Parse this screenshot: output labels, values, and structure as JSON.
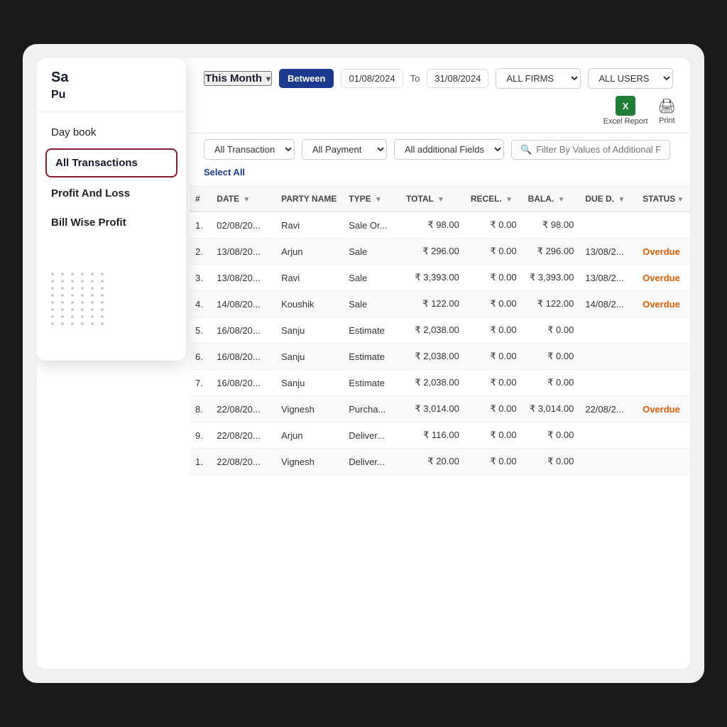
{
  "screen": {
    "title": "Sales Report"
  },
  "sidebar": {
    "title_sa": "Sa",
    "title_pu": "Pu",
    "items": [
      {
        "id": "day-book",
        "label": "Day book",
        "active": false
      },
      {
        "id": "all-transactions",
        "label": "All Transactions",
        "active": true
      },
      {
        "id": "profit-and-loss",
        "label": "Profit And Loss",
        "active": false
      },
      {
        "id": "bill-wise-profit",
        "label": "Bill Wise Profit",
        "active": false
      }
    ],
    "dots_rows": 8,
    "dots_cols": 6
  },
  "filter_bar": {
    "month_label": "This Month",
    "between_label": "Between",
    "date_from": "01/08/2024",
    "date_to_label": "To",
    "date_to": "31/08/2024",
    "all_firms_label": "ALL FIRMS",
    "all_users_label": "ALL USERS",
    "excel_label": "Excel Report",
    "print_label": "Print"
  },
  "filter_bar2": {
    "all_transaction_label": "All Transaction",
    "all_payment_label": "All Payment",
    "additional_fields_label": "All additional Fields",
    "search_placeholder": "Filter By Values of Additional Fields",
    "select_all_label": "Select All"
  },
  "table": {
    "columns": [
      "#",
      "DATE",
      "PARTY NAME",
      "TYPE",
      "TOTAL",
      "RECEL.",
      "BALA.",
      "DUE D.",
      "STATUS"
    ],
    "rows": [
      {
        "num": "1.",
        "date": "02/08/20...",
        "party": "Ravi",
        "type": "Sale Or...",
        "total": "₹ 98.00",
        "recel": "₹ 0.00",
        "bala": "₹ 98.00",
        "dued": "",
        "status": ""
      },
      {
        "num": "2.",
        "date": "13/08/20...",
        "party": "Arjun",
        "type": "Sale",
        "total": "₹ 296.00",
        "recel": "₹ 0.00",
        "bala": "₹ 296.00",
        "dued": "13/08/2...",
        "status": "Overdue"
      },
      {
        "num": "3.",
        "date": "13/08/20...",
        "party": "Ravi",
        "type": "Sale",
        "total": "₹ 3,393.00",
        "recel": "₹ 0.00",
        "bala": "₹ 3,393.00",
        "dued": "13/08/2...",
        "status": "Overdue"
      },
      {
        "num": "4.",
        "date": "14/08/20...",
        "party": "Koushik",
        "type": "Sale",
        "total": "₹ 122.00",
        "recel": "₹ 0.00",
        "bala": "₹ 122.00",
        "dued": "14/08/2...",
        "status": "Overdue"
      },
      {
        "num": "5.",
        "date": "16/08/20...",
        "party": "Sanju",
        "type": "Estimate",
        "total": "₹ 2,038.00",
        "recel": "₹ 0.00",
        "bala": "₹ 0.00",
        "dued": "",
        "status": ""
      },
      {
        "num": "6.",
        "date": "16/08/20...",
        "party": "Sanju",
        "type": "Estimate",
        "total": "₹ 2,038.00",
        "recel": "₹ 0.00",
        "bala": "₹ 0.00",
        "dued": "",
        "status": ""
      },
      {
        "num": "7.",
        "date": "16/08/20...",
        "party": "Sanju",
        "type": "Estimate",
        "total": "₹ 2,038.00",
        "recel": "₹ 0.00",
        "bala": "₹ 0.00",
        "dued": "",
        "status": ""
      },
      {
        "num": "8.",
        "date": "22/08/20...",
        "party": "Vignesh",
        "type": "Purcha...",
        "total": "₹ 3,014.00",
        "recel": "₹ 0.00",
        "bala": "₹ 3,014.00",
        "dued": "22/08/2...",
        "status": "Overdue"
      },
      {
        "num": "9.",
        "date": "22/08/20...",
        "party": "Arjun",
        "type": "Deliver...",
        "total": "₹ 116.00",
        "recel": "₹ 0.00",
        "bala": "₹ 0.00",
        "dued": "",
        "status": ""
      },
      {
        "num": "1.",
        "date": "22/08/20...",
        "party": "Vignesh",
        "type": "Deliver...",
        "total": "₹ 20.00",
        "recel": "₹ 0.00",
        "bala": "₹ 0.00",
        "dued": "",
        "status": ""
      }
    ]
  }
}
